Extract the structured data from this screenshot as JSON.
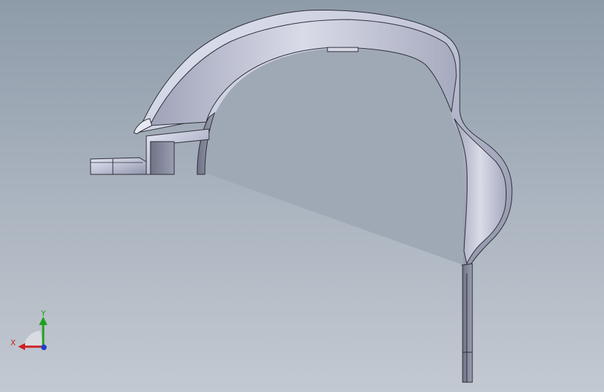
{
  "viewport": {
    "background_top": "#8e9ba9",
    "background_bottom": "#c3c9d1",
    "part_color": "#bfc3d6",
    "part_edge_color": "#2a2a33"
  },
  "triad": {
    "x_label": "X",
    "y_label": "Y",
    "x_color": "#cc1f1f",
    "y_color": "#1fa01f",
    "z_color": "#1f3fcc"
  }
}
